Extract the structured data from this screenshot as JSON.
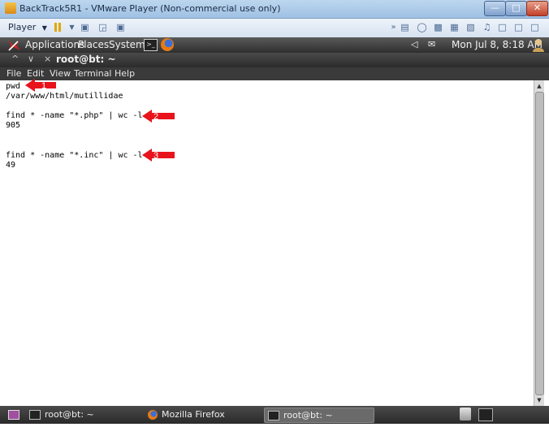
{
  "vmware": {
    "title": "BackTrack5R1 - VMware Player (Non-commercial use only)",
    "player_menu": "Player",
    "minimize": "—",
    "maximize": "□",
    "close": "✕"
  },
  "gnome_panel": {
    "applications": "Applications",
    "places": "Places",
    "system": "System",
    "clock": "Mon Jul  8,  8:18 AM"
  },
  "terminal": {
    "title": "root@bt: ~",
    "menu": [
      "File",
      "Edit",
      "View",
      "Terminal",
      "Help"
    ],
    "lines": [
      "pwd",
      "/var/www/html/mutillidae",
      "",
      "find * -name \"*.php\" | wc -l",
      "905",
      "",
      "",
      "find * -name \"*.inc\" | wc -l",
      "49"
    ]
  },
  "annotations": [
    {
      "number": "1",
      "color": "#e8131b"
    },
    {
      "number": "2",
      "color": "#e8131b"
    },
    {
      "number": "3",
      "color": "#e8131b"
    }
  ],
  "taskbar": {
    "tasks": [
      {
        "label": "root@bt: ~",
        "icon": "terminal-icon"
      },
      {
        "label": "Mozilla Firefox",
        "icon": "firefox-icon"
      },
      {
        "label": "root@bt: ~",
        "icon": "terminal-icon",
        "active": true
      }
    ]
  }
}
